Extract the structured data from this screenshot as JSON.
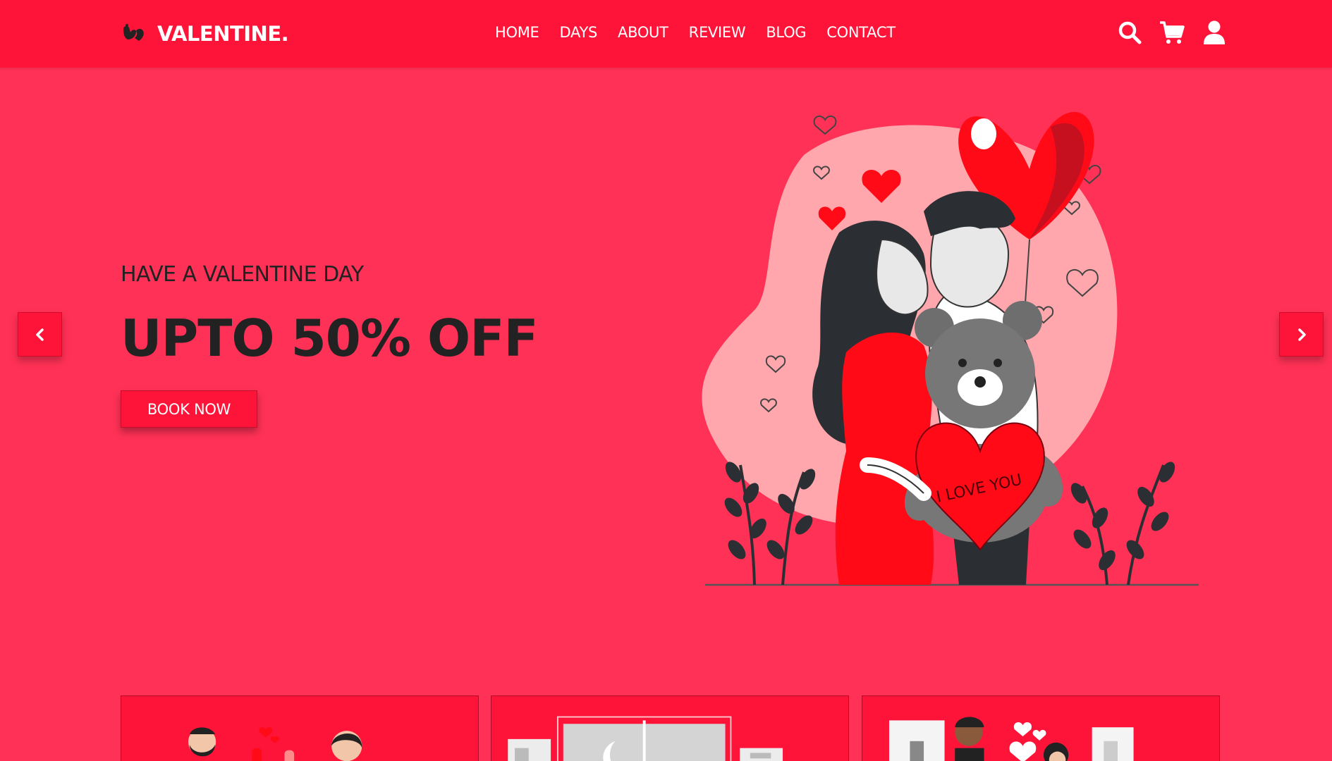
{
  "header": {
    "logo": {
      "text": "VALENTINE.",
      "icon": "hands-heart-icon"
    },
    "nav": [
      {
        "label": "HOME"
      },
      {
        "label": "DAYS"
      },
      {
        "label": "ABOUT"
      },
      {
        "label": "REVIEW"
      },
      {
        "label": "BLOG"
      },
      {
        "label": "CONTACT"
      }
    ],
    "icons": [
      "search-icon",
      "cart-icon",
      "user-icon"
    ]
  },
  "hero": {
    "subtitle": "HAVE A VALENTINE DAY",
    "title": "UPTO 50% OFF",
    "button_label": "BOOK NOW",
    "prev_icon": "chevron-left-icon",
    "next_icon": "chevron-right-icon",
    "illustration_text": "I LOVE YOU"
  },
  "colors": {
    "header_bg": "#ff1439",
    "page_bg": "#ff3156",
    "accent": "#ff1439",
    "text_dark": "#222222",
    "text_light": "#ffffff"
  }
}
